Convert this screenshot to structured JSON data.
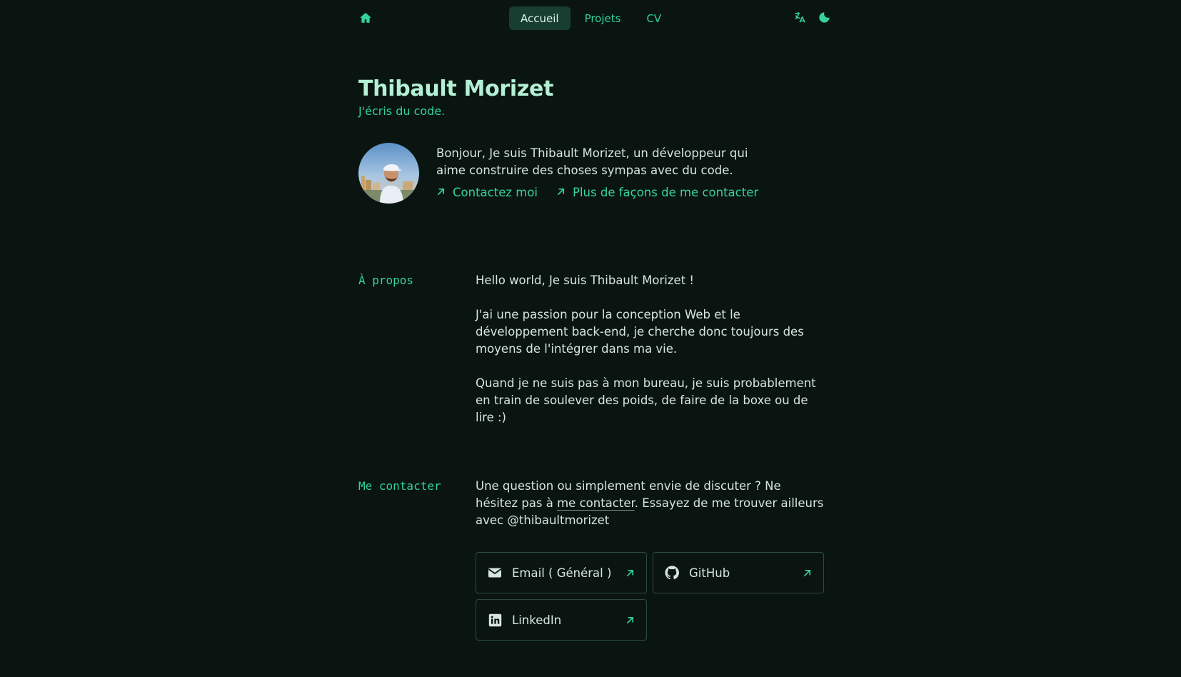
{
  "colors": {
    "background": "#0a1512",
    "accent": "#34d399",
    "heading": "#b3f0d4",
    "text": "#d6e6df",
    "active_tab_bg": "#183d31",
    "card_border": "#2c4a40"
  },
  "nav": {
    "home_icon": "home-icon",
    "tabs": [
      {
        "label": "Accueil",
        "active": true
      },
      {
        "label": "Projets",
        "active": false
      },
      {
        "label": "CV",
        "active": false
      }
    ],
    "translate_icon": "translate-icon",
    "theme_icon": "moon-icon"
  },
  "hero": {
    "name": "Thibault Morizet",
    "tagline": "J'écris du code.",
    "intro": "Bonjour, Je suis Thibault Morizet, un développeur qui aime construire des choses sympas avec du code.",
    "links": [
      {
        "label": "Contactez moi",
        "icon": "arrow-up-right-icon"
      },
      {
        "label": "Plus de façons de me contacter",
        "icon": "arrow-up-right-icon"
      }
    ]
  },
  "about": {
    "label": "À propos",
    "paragraphs": [
      "Hello world, Je suis Thibault Morizet !",
      "J'ai une passion pour la conception Web et le développement back-end, je cherche donc toujours des moyens de l'intégrer dans ma vie.",
      "Quand je ne suis pas à mon bureau, je suis probablement en train de soulever des poids, de faire de la boxe ou de lire :)"
    ]
  },
  "contact": {
    "label": "Me contacter",
    "text_before": "Une question ou simplement envie de discuter ? Ne hésitez pas à ",
    "link_text": "me contacter",
    "text_after": ". Essayez de me trouver ailleurs avec @thibaultmorizet",
    "cards": [
      {
        "label": "Email ( Général )",
        "icon": "mail-icon"
      },
      {
        "label": "GitHub",
        "icon": "github-icon"
      },
      {
        "label": "LinkedIn",
        "icon": "linkedin-icon"
      }
    ]
  }
}
